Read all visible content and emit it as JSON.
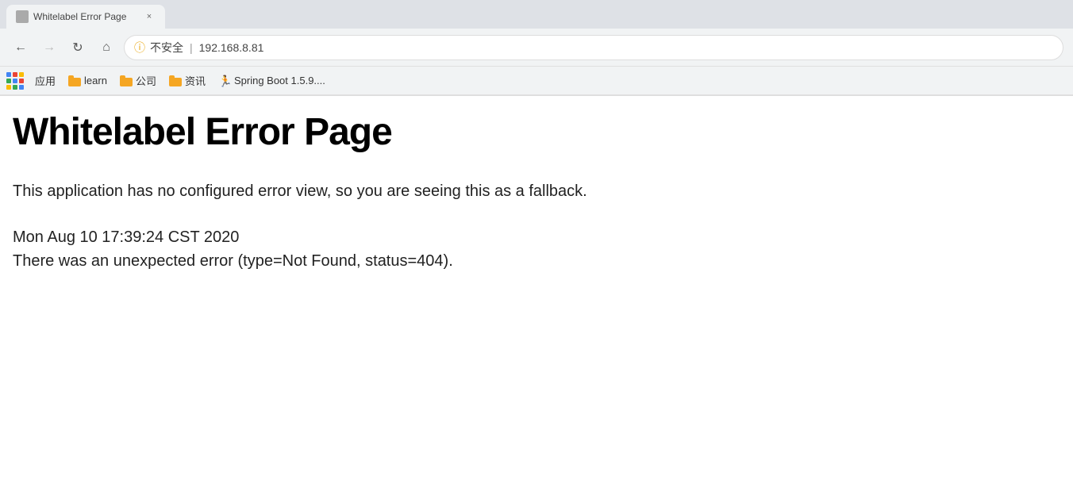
{
  "browser": {
    "tab": {
      "title": "Whitelabel Error Page"
    },
    "nav": {
      "back_disabled": false,
      "forward_disabled": true,
      "security_label": "不安全",
      "url": "192.168.8.81"
    },
    "bookmarks": {
      "apps_label": "应用",
      "items": [
        {
          "id": "learn",
          "label": "learn",
          "type": "folder"
        },
        {
          "id": "company",
          "label": "公司",
          "type": "folder"
        },
        {
          "id": "news",
          "label": "资讯",
          "type": "folder"
        },
        {
          "id": "springboot",
          "label": "Spring Boot 1.5.9....",
          "type": "link"
        }
      ]
    }
  },
  "page": {
    "title": "Whitelabel Error Page",
    "description": "This application has no configured error view, so you are seeing this as a fallback.",
    "timestamp": "Mon Aug 10 17:39:24 CST 2020",
    "error_detail": "There was an unexpected error (type=Not Found, status=404)."
  },
  "icons": {
    "back": "←",
    "forward": "→",
    "reload": "↻",
    "home": "⌂",
    "security": "ⓘ"
  },
  "colors": {
    "folder_orange": "#f5a623",
    "spring_green": "#6db33f",
    "dot_blue": "#4285f4",
    "dot_red": "#ea4335",
    "dot_yellow": "#fbbc05",
    "dot_green": "#34a853"
  }
}
